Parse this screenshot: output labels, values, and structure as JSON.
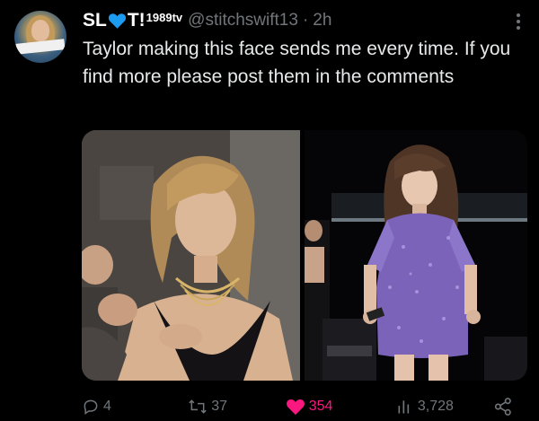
{
  "tweet": {
    "author": {
      "name_start": "SL",
      "name_heart_icon": "blue-heart-icon",
      "name_end": "T!",
      "name_superscript": "1989tv",
      "handle": "@stitchswift13",
      "separator": "·",
      "time": "2h"
    },
    "text": "Taylor making this face sends me every time. If you find more please post them in the comments",
    "media": [
      {
        "kind": "photo",
        "subject": "close-up in black dress with gold necklaces"
      },
      {
        "kind": "photo",
        "subject": "on stage in sparkly purple sequin dress"
      }
    ],
    "stats": {
      "replies": "4",
      "reposts": "37",
      "likes": "354",
      "views": "3,728"
    }
  },
  "colors": {
    "background": "#000000",
    "text": "#e7e9ea",
    "secondary": "#71767b",
    "like": "#f91880",
    "heart": "#1d9bf0"
  }
}
